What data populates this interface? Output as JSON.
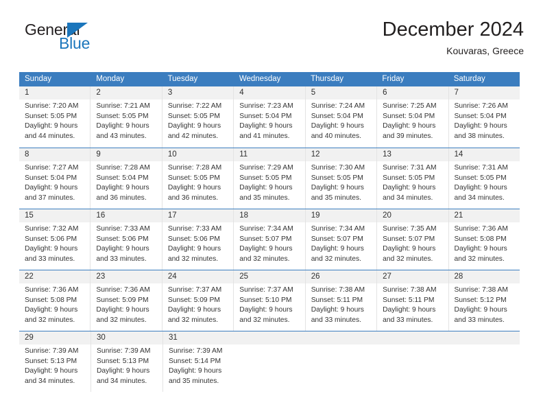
{
  "brand": {
    "name_top": "General",
    "name_bottom": "Blue",
    "triangle_color": "#1b76bc"
  },
  "header": {
    "title": "December 2024",
    "subtitle": "Kouvaras, Greece"
  },
  "colors": {
    "header_blue": "#3b7dbf",
    "daynum_band": "#f1f1f1",
    "brand_blue": "#1b76bc",
    "text": "#333333"
  },
  "weekdays": [
    "Sunday",
    "Monday",
    "Tuesday",
    "Wednesday",
    "Thursday",
    "Friday",
    "Saturday"
  ],
  "weeks": [
    [
      {
        "day": "1",
        "sunrise": "Sunrise: 7:20 AM",
        "sunset": "Sunset: 5:05 PM",
        "daylight1": "Daylight: 9 hours",
        "daylight2": "and 44 minutes."
      },
      {
        "day": "2",
        "sunrise": "Sunrise: 7:21 AM",
        "sunset": "Sunset: 5:05 PM",
        "daylight1": "Daylight: 9 hours",
        "daylight2": "and 43 minutes."
      },
      {
        "day": "3",
        "sunrise": "Sunrise: 7:22 AM",
        "sunset": "Sunset: 5:05 PM",
        "daylight1": "Daylight: 9 hours",
        "daylight2": "and 42 minutes."
      },
      {
        "day": "4",
        "sunrise": "Sunrise: 7:23 AM",
        "sunset": "Sunset: 5:04 PM",
        "daylight1": "Daylight: 9 hours",
        "daylight2": "and 41 minutes."
      },
      {
        "day": "5",
        "sunrise": "Sunrise: 7:24 AM",
        "sunset": "Sunset: 5:04 PM",
        "daylight1": "Daylight: 9 hours",
        "daylight2": "and 40 minutes."
      },
      {
        "day": "6",
        "sunrise": "Sunrise: 7:25 AM",
        "sunset": "Sunset: 5:04 PM",
        "daylight1": "Daylight: 9 hours",
        "daylight2": "and 39 minutes."
      },
      {
        "day": "7",
        "sunrise": "Sunrise: 7:26 AM",
        "sunset": "Sunset: 5:04 PM",
        "daylight1": "Daylight: 9 hours",
        "daylight2": "and 38 minutes."
      }
    ],
    [
      {
        "day": "8",
        "sunrise": "Sunrise: 7:27 AM",
        "sunset": "Sunset: 5:04 PM",
        "daylight1": "Daylight: 9 hours",
        "daylight2": "and 37 minutes."
      },
      {
        "day": "9",
        "sunrise": "Sunrise: 7:28 AM",
        "sunset": "Sunset: 5:04 PM",
        "daylight1": "Daylight: 9 hours",
        "daylight2": "and 36 minutes."
      },
      {
        "day": "10",
        "sunrise": "Sunrise: 7:28 AM",
        "sunset": "Sunset: 5:05 PM",
        "daylight1": "Daylight: 9 hours",
        "daylight2": "and 36 minutes."
      },
      {
        "day": "11",
        "sunrise": "Sunrise: 7:29 AM",
        "sunset": "Sunset: 5:05 PM",
        "daylight1": "Daylight: 9 hours",
        "daylight2": "and 35 minutes."
      },
      {
        "day": "12",
        "sunrise": "Sunrise: 7:30 AM",
        "sunset": "Sunset: 5:05 PM",
        "daylight1": "Daylight: 9 hours",
        "daylight2": "and 35 minutes."
      },
      {
        "day": "13",
        "sunrise": "Sunrise: 7:31 AM",
        "sunset": "Sunset: 5:05 PM",
        "daylight1": "Daylight: 9 hours",
        "daylight2": "and 34 minutes."
      },
      {
        "day": "14",
        "sunrise": "Sunrise: 7:31 AM",
        "sunset": "Sunset: 5:05 PM",
        "daylight1": "Daylight: 9 hours",
        "daylight2": "and 34 minutes."
      }
    ],
    [
      {
        "day": "15",
        "sunrise": "Sunrise: 7:32 AM",
        "sunset": "Sunset: 5:06 PM",
        "daylight1": "Daylight: 9 hours",
        "daylight2": "and 33 minutes."
      },
      {
        "day": "16",
        "sunrise": "Sunrise: 7:33 AM",
        "sunset": "Sunset: 5:06 PM",
        "daylight1": "Daylight: 9 hours",
        "daylight2": "and 33 minutes."
      },
      {
        "day": "17",
        "sunrise": "Sunrise: 7:33 AM",
        "sunset": "Sunset: 5:06 PM",
        "daylight1": "Daylight: 9 hours",
        "daylight2": "and 32 minutes."
      },
      {
        "day": "18",
        "sunrise": "Sunrise: 7:34 AM",
        "sunset": "Sunset: 5:07 PM",
        "daylight1": "Daylight: 9 hours",
        "daylight2": "and 32 minutes."
      },
      {
        "day": "19",
        "sunrise": "Sunrise: 7:34 AM",
        "sunset": "Sunset: 5:07 PM",
        "daylight1": "Daylight: 9 hours",
        "daylight2": "and 32 minutes."
      },
      {
        "day": "20",
        "sunrise": "Sunrise: 7:35 AM",
        "sunset": "Sunset: 5:07 PM",
        "daylight1": "Daylight: 9 hours",
        "daylight2": "and 32 minutes."
      },
      {
        "day": "21",
        "sunrise": "Sunrise: 7:36 AM",
        "sunset": "Sunset: 5:08 PM",
        "daylight1": "Daylight: 9 hours",
        "daylight2": "and 32 minutes."
      }
    ],
    [
      {
        "day": "22",
        "sunrise": "Sunrise: 7:36 AM",
        "sunset": "Sunset: 5:08 PM",
        "daylight1": "Daylight: 9 hours",
        "daylight2": "and 32 minutes."
      },
      {
        "day": "23",
        "sunrise": "Sunrise: 7:36 AM",
        "sunset": "Sunset: 5:09 PM",
        "daylight1": "Daylight: 9 hours",
        "daylight2": "and 32 minutes."
      },
      {
        "day": "24",
        "sunrise": "Sunrise: 7:37 AM",
        "sunset": "Sunset: 5:09 PM",
        "daylight1": "Daylight: 9 hours",
        "daylight2": "and 32 minutes."
      },
      {
        "day": "25",
        "sunrise": "Sunrise: 7:37 AM",
        "sunset": "Sunset: 5:10 PM",
        "daylight1": "Daylight: 9 hours",
        "daylight2": "and 32 minutes."
      },
      {
        "day": "26",
        "sunrise": "Sunrise: 7:38 AM",
        "sunset": "Sunset: 5:11 PM",
        "daylight1": "Daylight: 9 hours",
        "daylight2": "and 33 minutes."
      },
      {
        "day": "27",
        "sunrise": "Sunrise: 7:38 AM",
        "sunset": "Sunset: 5:11 PM",
        "daylight1": "Daylight: 9 hours",
        "daylight2": "and 33 minutes."
      },
      {
        "day": "28",
        "sunrise": "Sunrise: 7:38 AM",
        "sunset": "Sunset: 5:12 PM",
        "daylight1": "Daylight: 9 hours",
        "daylight2": "and 33 minutes."
      }
    ],
    [
      {
        "day": "29",
        "sunrise": "Sunrise: 7:39 AM",
        "sunset": "Sunset: 5:13 PM",
        "daylight1": "Daylight: 9 hours",
        "daylight2": "and 34 minutes."
      },
      {
        "day": "30",
        "sunrise": "Sunrise: 7:39 AM",
        "sunset": "Sunset: 5:13 PM",
        "daylight1": "Daylight: 9 hours",
        "daylight2": "and 34 minutes."
      },
      {
        "day": "31",
        "sunrise": "Sunrise: 7:39 AM",
        "sunset": "Sunset: 5:14 PM",
        "daylight1": "Daylight: 9 hours",
        "daylight2": "and 35 minutes."
      },
      {
        "day": "",
        "sunrise": "",
        "sunset": "",
        "daylight1": "",
        "daylight2": ""
      },
      {
        "day": "",
        "sunrise": "",
        "sunset": "",
        "daylight1": "",
        "daylight2": ""
      },
      {
        "day": "",
        "sunrise": "",
        "sunset": "",
        "daylight1": "",
        "daylight2": ""
      },
      {
        "day": "",
        "sunrise": "",
        "sunset": "",
        "daylight1": "",
        "daylight2": ""
      }
    ]
  ]
}
